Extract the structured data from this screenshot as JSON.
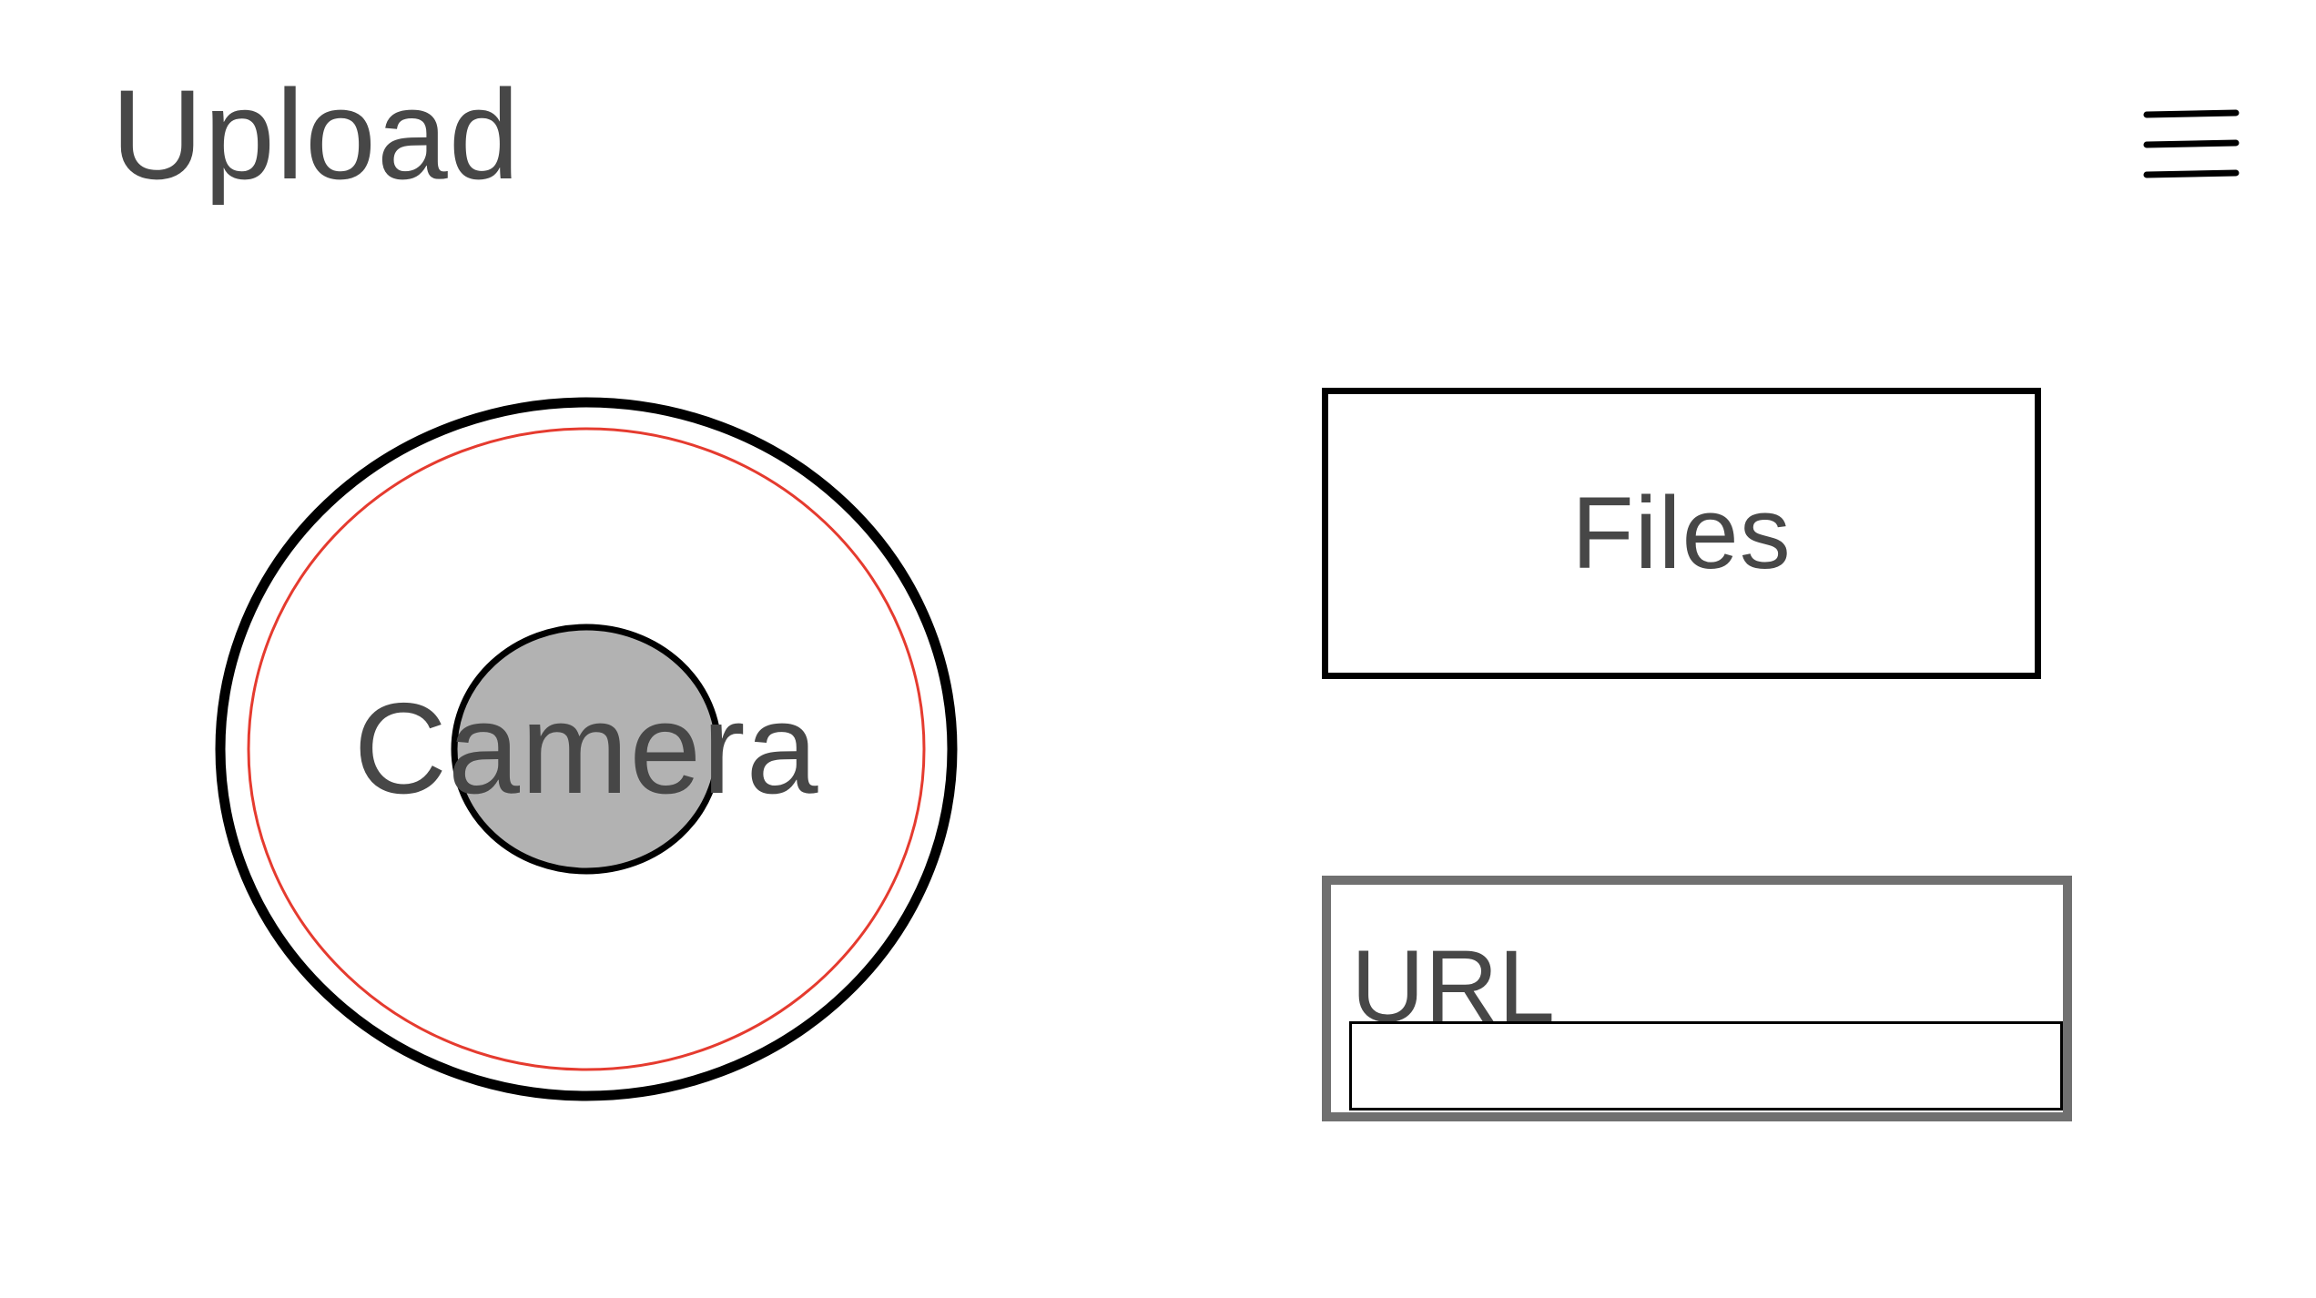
{
  "header": {
    "title": "Upload",
    "menu_icon": "hamburger-menu-icon"
  },
  "camera": {
    "label": "Camera",
    "icon": "camera-shutter-icon",
    "colors": {
      "outer_ring": "#000000",
      "inner_ring": "#e53b2f",
      "shutter_fill": "#b2b2b2"
    }
  },
  "files": {
    "label": "Files"
  },
  "url": {
    "label": "URL",
    "value": "",
    "placeholder": ""
  }
}
